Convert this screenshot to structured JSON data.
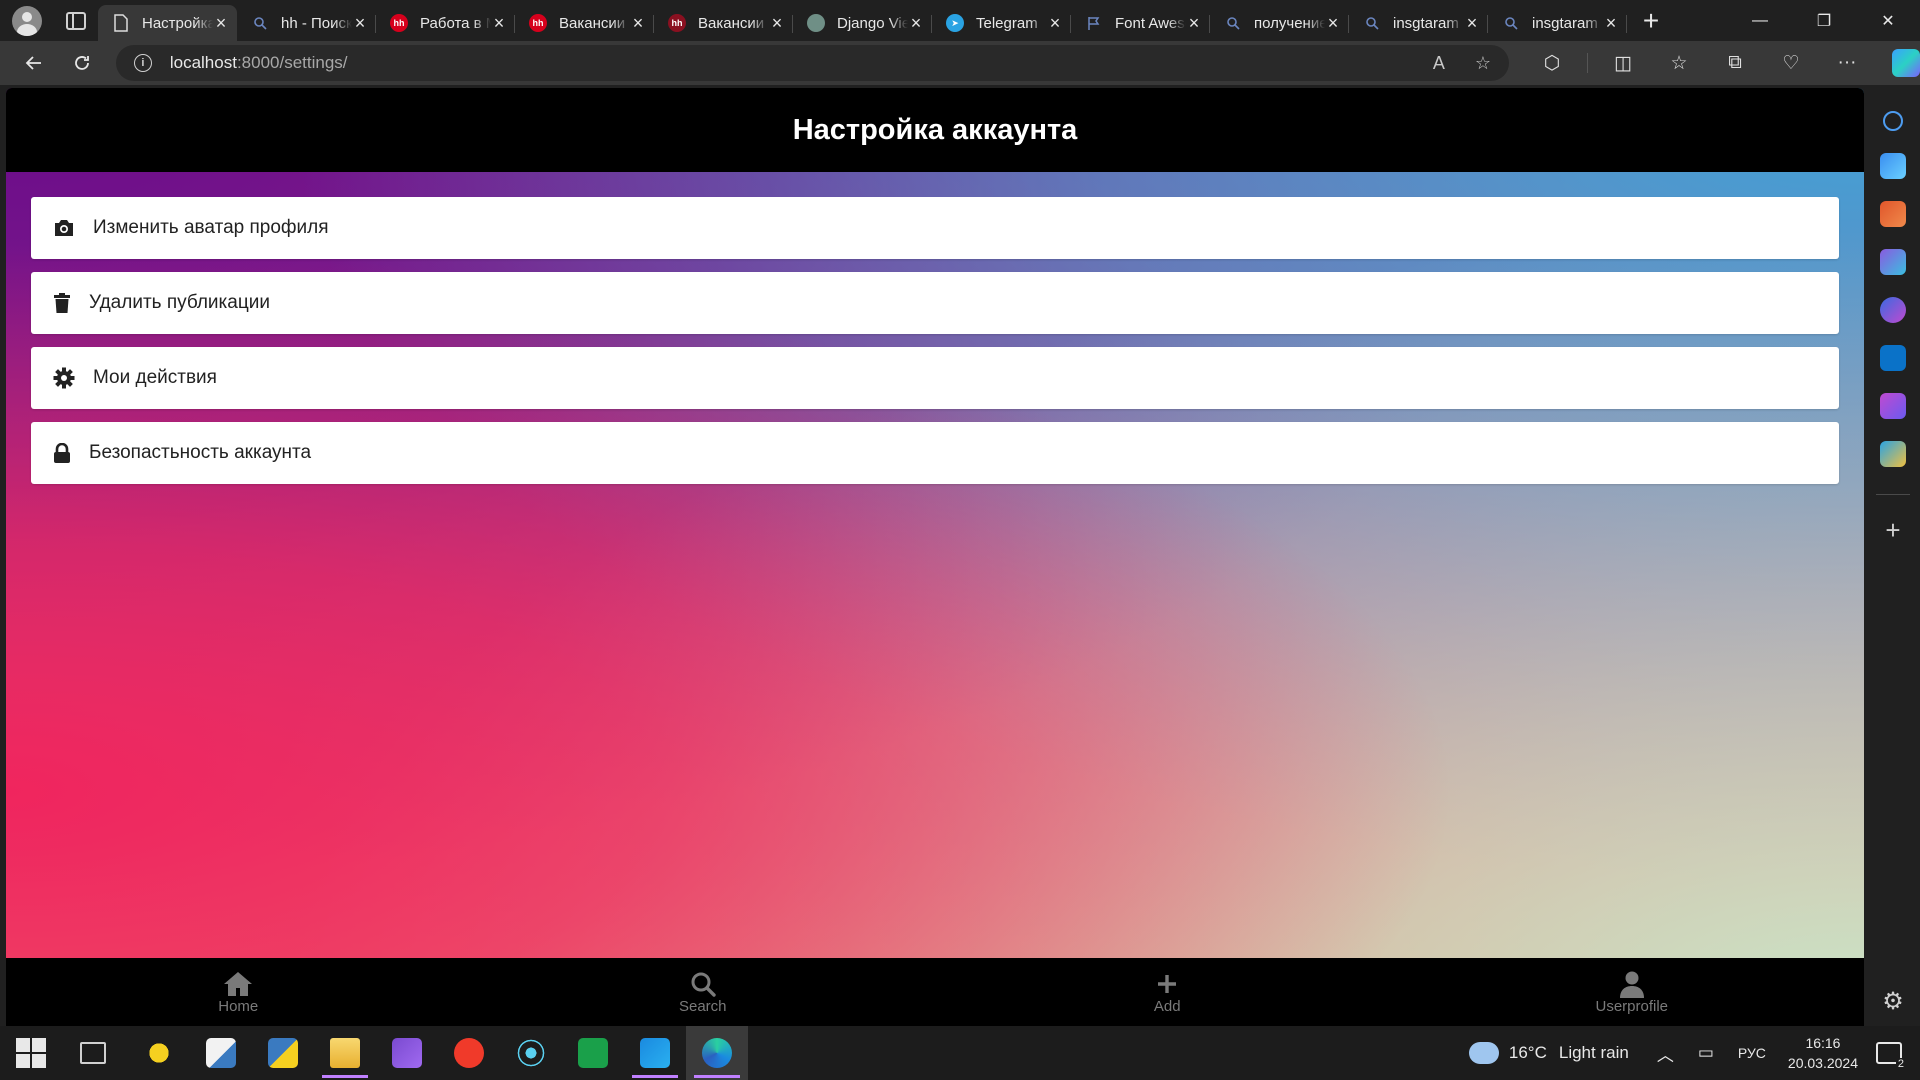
{
  "browser": {
    "tabs": [
      {
        "title": "Настройка аккаунта",
        "favicon": "page-icon",
        "color": "#5a5a5a"
      },
      {
        "title": "hh - Поиск",
        "favicon": "search-icon",
        "color": "#5a6a8a"
      },
      {
        "title": "Работа в Москве",
        "favicon": "hh-icon",
        "color": "#d6001c"
      },
      {
        "title": "Вакансии",
        "favicon": "hh-icon",
        "color": "#d6001c"
      },
      {
        "title": "Вакансии",
        "favicon": "hh-icon",
        "color": "#8a1020"
      },
      {
        "title": "Django View",
        "favicon": "chatgpt-icon",
        "color": "#10a37f"
      },
      {
        "title": "Telegram",
        "favicon": "telegram-icon",
        "color": "#2aa3e3"
      },
      {
        "title": "Font Awesome",
        "favicon": "flag-icon",
        "color": "#4a6ca8"
      },
      {
        "title": "получение",
        "favicon": "search-icon",
        "color": "#5a6a8a"
      },
      {
        "title": "insgtaram",
        "favicon": "search-icon",
        "color": "#5a6a8a"
      },
      {
        "title": "insgtaram",
        "favicon": "search-icon",
        "color": "#5a6a8a"
      }
    ],
    "address": {
      "host": "localhost",
      "path": ":8000/settings/"
    }
  },
  "page": {
    "title": "Настройка аккаунта",
    "settings": [
      {
        "label": "Изменить аватар профиля",
        "icon": "camera-icon"
      },
      {
        "label": "Удалить публикации",
        "icon": "trash-icon"
      },
      {
        "label": "Мои действия",
        "icon": "gear-icon"
      },
      {
        "label": "Безопастьность аккаунта",
        "icon": "lock-icon"
      }
    ],
    "bottom_nav": [
      {
        "label": "Home",
        "icon": "home-icon"
      },
      {
        "label": "Search",
        "icon": "search-icon"
      },
      {
        "label": "Add",
        "icon": "plus-icon"
      },
      {
        "label": "Userprofile",
        "icon": "user-icon"
      }
    ]
  },
  "taskbar": {
    "weather": {
      "temp": "16°C",
      "text": "Light rain"
    },
    "lang": "РУС",
    "time": "16:16",
    "date": "20.03.2024",
    "notifications": "2"
  }
}
